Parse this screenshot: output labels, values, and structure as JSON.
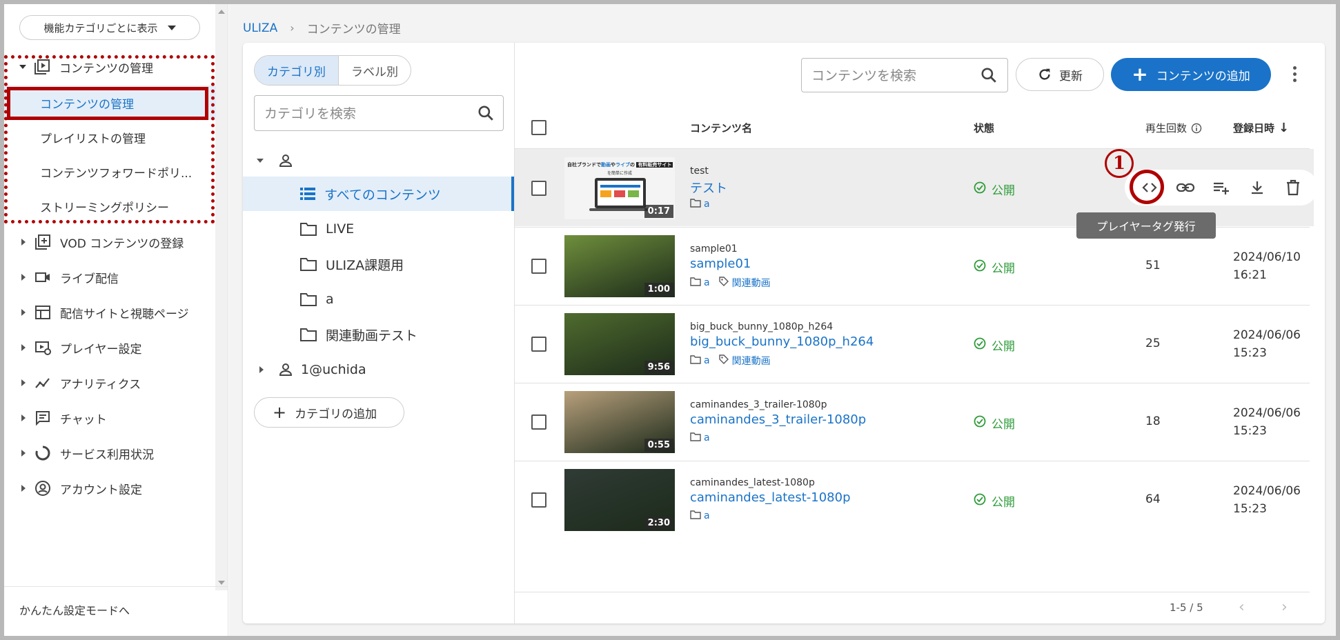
{
  "sidebar": {
    "mode_select": "機能カテゴリごとに表示",
    "group_contents": "コンテンツの管理",
    "sub_items": [
      "コンテンツの管理",
      "プレイリストの管理",
      "コンテンツフォワードポリ...",
      "ストリーミングポリシー"
    ],
    "nav_items": [
      {
        "label": "VOD コンテンツの登録",
        "icon": "add-box-icon"
      },
      {
        "label": "ライブ配信",
        "icon": "video-camera-icon"
      },
      {
        "label": "配信サイトと視聴ページ",
        "icon": "layout-icon"
      },
      {
        "label": "プレイヤー設定",
        "icon": "player-settings-icon"
      },
      {
        "label": "アナリティクス",
        "icon": "analytics-icon"
      },
      {
        "label": "チャット",
        "icon": "chat-icon"
      },
      {
        "label": "サービス利用状況",
        "icon": "usage-icon"
      },
      {
        "label": "アカウント設定",
        "icon": "account-icon"
      }
    ],
    "easy_mode": "かんたん設定モードへ"
  },
  "breadcrumb": {
    "root": "ULIZA",
    "current": "コンテンツの管理"
  },
  "category_panel": {
    "tab_category": "カテゴリ別",
    "tab_label": "ラベル別",
    "search_placeholder": "カテゴリを検索",
    "all_contents": "すべてのコンテンツ",
    "folders": [
      "LIVE",
      "ULIZA課題用",
      "a",
      "関連動画テスト"
    ],
    "user_node": "1@uchida",
    "add_category": "カテゴリの追加"
  },
  "toolbar": {
    "search_placeholder": "コンテンツを検索",
    "refresh": "更新",
    "add_content": "コンテンツの追加"
  },
  "table": {
    "headers": {
      "name": "コンテンツ名",
      "status": "状態",
      "plays": "再生回数",
      "registered": "登録日時"
    },
    "rows": [
      {
        "sub": "test",
        "title": "テスト",
        "folder": "a",
        "label": "",
        "status": "公開",
        "plays": "",
        "date": "",
        "time": "",
        "duration": "0:17",
        "thumb_color": "#e8e8e8"
      },
      {
        "sub": "sample01",
        "title": "sample01",
        "folder": "a",
        "label": "関連動画",
        "status": "公開",
        "plays": "51",
        "date": "2024/06/10",
        "time": "16:21",
        "duration": "1:00",
        "thumb_color": "#6f8f3c"
      },
      {
        "sub": "big_buck_bunny_1080p_h264",
        "title": "big_buck_bunny_1080p_h264",
        "folder": "a",
        "label": "関連動画",
        "status": "公開",
        "plays": "25",
        "date": "2024/06/06",
        "time": "15:23",
        "duration": "9:56",
        "thumb_color": "#4f6b2e"
      },
      {
        "sub": "caminandes_3_trailer-1080p",
        "title": "caminandes_3_trailer-1080p",
        "folder": "a",
        "label": "",
        "status": "公開",
        "plays": "18",
        "date": "2024/06/06",
        "time": "15:23",
        "duration": "0:55",
        "thumb_color": "#b8a07c"
      },
      {
        "sub": "caminandes_latest-1080p",
        "title": "caminandes_latest-1080p",
        "folder": "a",
        "label": "",
        "status": "公開",
        "plays": "64",
        "date": "2024/06/06",
        "time": "15:23",
        "duration": "2:30",
        "thumb_color": "#2f3b35"
      }
    ],
    "thumb_banner": {
      "part1": "自社ブランドで",
      "hl1": "動画",
      "part2": "や",
      "hl2": "ライブ",
      "part3": "の",
      "badge": "有料販売サイト",
      "line2": "を簡単に作成"
    },
    "row_actions": [
      "embed-code-icon",
      "link-icon",
      "playlist-add-icon",
      "download-icon",
      "delete-icon"
    ],
    "tooltip": "プレイヤータグ発行",
    "annotation_number": "1",
    "pager": "1-5 / 5"
  },
  "colors": {
    "accent": "#1a73c8",
    "published": "#2e9c3a",
    "annotation": "#b00000"
  }
}
